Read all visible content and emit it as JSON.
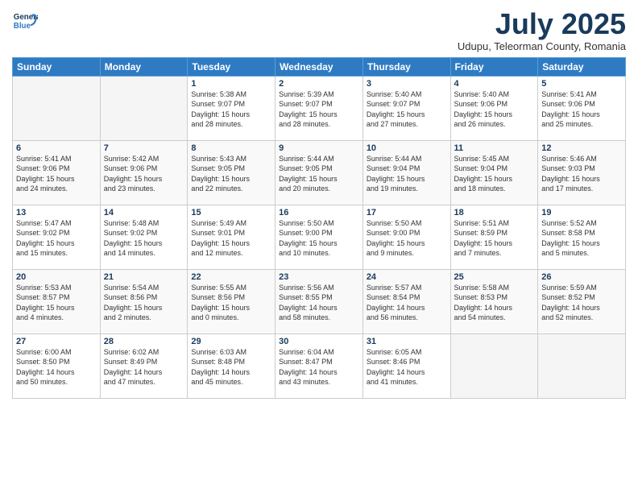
{
  "logo": {
    "line1": "General",
    "line2": "Blue"
  },
  "title": "July 2025",
  "subtitle": "Udupu, Teleorman County, Romania",
  "days_header": [
    "Sunday",
    "Monday",
    "Tuesday",
    "Wednesday",
    "Thursday",
    "Friday",
    "Saturday"
  ],
  "weeks": [
    [
      {
        "day": "",
        "info": ""
      },
      {
        "day": "",
        "info": ""
      },
      {
        "day": "1",
        "info": "Sunrise: 5:38 AM\nSunset: 9:07 PM\nDaylight: 15 hours\nand 28 minutes."
      },
      {
        "day": "2",
        "info": "Sunrise: 5:39 AM\nSunset: 9:07 PM\nDaylight: 15 hours\nand 28 minutes."
      },
      {
        "day": "3",
        "info": "Sunrise: 5:40 AM\nSunset: 9:07 PM\nDaylight: 15 hours\nand 27 minutes."
      },
      {
        "day": "4",
        "info": "Sunrise: 5:40 AM\nSunset: 9:06 PM\nDaylight: 15 hours\nand 26 minutes."
      },
      {
        "day": "5",
        "info": "Sunrise: 5:41 AM\nSunset: 9:06 PM\nDaylight: 15 hours\nand 25 minutes."
      }
    ],
    [
      {
        "day": "6",
        "info": "Sunrise: 5:41 AM\nSunset: 9:06 PM\nDaylight: 15 hours\nand 24 minutes."
      },
      {
        "day": "7",
        "info": "Sunrise: 5:42 AM\nSunset: 9:06 PM\nDaylight: 15 hours\nand 23 minutes."
      },
      {
        "day": "8",
        "info": "Sunrise: 5:43 AM\nSunset: 9:05 PM\nDaylight: 15 hours\nand 22 minutes."
      },
      {
        "day": "9",
        "info": "Sunrise: 5:44 AM\nSunset: 9:05 PM\nDaylight: 15 hours\nand 20 minutes."
      },
      {
        "day": "10",
        "info": "Sunrise: 5:44 AM\nSunset: 9:04 PM\nDaylight: 15 hours\nand 19 minutes."
      },
      {
        "day": "11",
        "info": "Sunrise: 5:45 AM\nSunset: 9:04 PM\nDaylight: 15 hours\nand 18 minutes."
      },
      {
        "day": "12",
        "info": "Sunrise: 5:46 AM\nSunset: 9:03 PM\nDaylight: 15 hours\nand 17 minutes."
      }
    ],
    [
      {
        "day": "13",
        "info": "Sunrise: 5:47 AM\nSunset: 9:02 PM\nDaylight: 15 hours\nand 15 minutes."
      },
      {
        "day": "14",
        "info": "Sunrise: 5:48 AM\nSunset: 9:02 PM\nDaylight: 15 hours\nand 14 minutes."
      },
      {
        "day": "15",
        "info": "Sunrise: 5:49 AM\nSunset: 9:01 PM\nDaylight: 15 hours\nand 12 minutes."
      },
      {
        "day": "16",
        "info": "Sunrise: 5:50 AM\nSunset: 9:00 PM\nDaylight: 15 hours\nand 10 minutes."
      },
      {
        "day": "17",
        "info": "Sunrise: 5:50 AM\nSunset: 9:00 PM\nDaylight: 15 hours\nand 9 minutes."
      },
      {
        "day": "18",
        "info": "Sunrise: 5:51 AM\nSunset: 8:59 PM\nDaylight: 15 hours\nand 7 minutes."
      },
      {
        "day": "19",
        "info": "Sunrise: 5:52 AM\nSunset: 8:58 PM\nDaylight: 15 hours\nand 5 minutes."
      }
    ],
    [
      {
        "day": "20",
        "info": "Sunrise: 5:53 AM\nSunset: 8:57 PM\nDaylight: 15 hours\nand 4 minutes."
      },
      {
        "day": "21",
        "info": "Sunrise: 5:54 AM\nSunset: 8:56 PM\nDaylight: 15 hours\nand 2 minutes."
      },
      {
        "day": "22",
        "info": "Sunrise: 5:55 AM\nSunset: 8:56 PM\nDaylight: 15 hours\nand 0 minutes."
      },
      {
        "day": "23",
        "info": "Sunrise: 5:56 AM\nSunset: 8:55 PM\nDaylight: 14 hours\nand 58 minutes."
      },
      {
        "day": "24",
        "info": "Sunrise: 5:57 AM\nSunset: 8:54 PM\nDaylight: 14 hours\nand 56 minutes."
      },
      {
        "day": "25",
        "info": "Sunrise: 5:58 AM\nSunset: 8:53 PM\nDaylight: 14 hours\nand 54 minutes."
      },
      {
        "day": "26",
        "info": "Sunrise: 5:59 AM\nSunset: 8:52 PM\nDaylight: 14 hours\nand 52 minutes."
      }
    ],
    [
      {
        "day": "27",
        "info": "Sunrise: 6:00 AM\nSunset: 8:50 PM\nDaylight: 14 hours\nand 50 minutes."
      },
      {
        "day": "28",
        "info": "Sunrise: 6:02 AM\nSunset: 8:49 PM\nDaylight: 14 hours\nand 47 minutes."
      },
      {
        "day": "29",
        "info": "Sunrise: 6:03 AM\nSunset: 8:48 PM\nDaylight: 14 hours\nand 45 minutes."
      },
      {
        "day": "30",
        "info": "Sunrise: 6:04 AM\nSunset: 8:47 PM\nDaylight: 14 hours\nand 43 minutes."
      },
      {
        "day": "31",
        "info": "Sunrise: 6:05 AM\nSunset: 8:46 PM\nDaylight: 14 hours\nand 41 minutes."
      },
      {
        "day": "",
        "info": ""
      },
      {
        "day": "",
        "info": ""
      }
    ]
  ]
}
